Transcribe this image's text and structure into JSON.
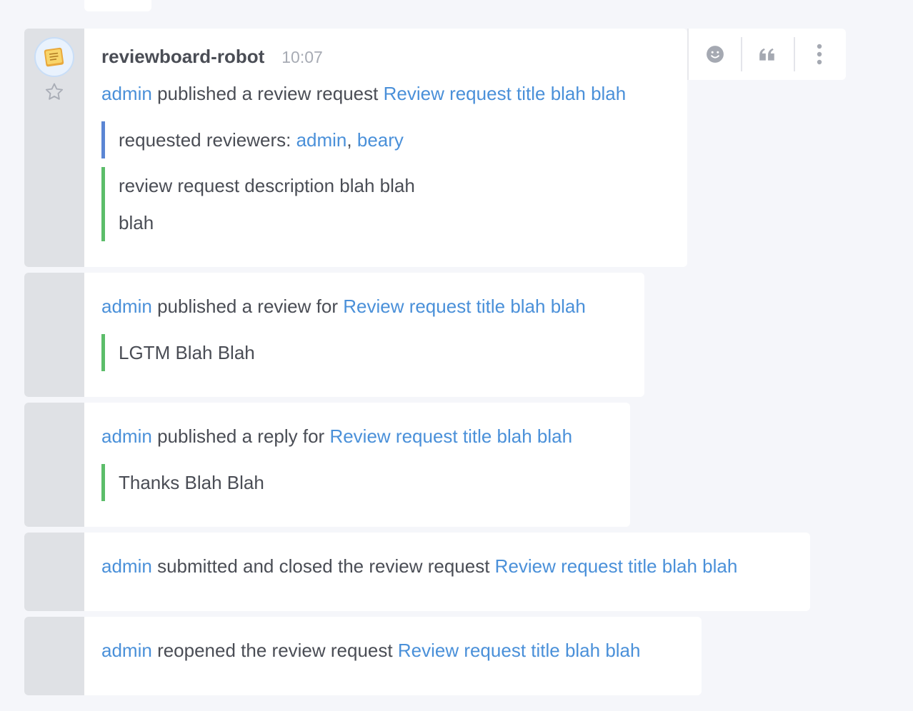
{
  "messages": {
    "m1": {
      "sender": "reviewboard-robot",
      "time": "10:07",
      "actor": "admin",
      "action": "published a review request",
      "link": "Review request title blah blah",
      "reviewers_prefix": "requested reviewers:",
      "reviewer_1": "admin",
      "reviewer_sep": ",",
      "reviewer_2": "beary",
      "description_line_1": "review request description blah blah",
      "description_line_2": "blah"
    },
    "m2": {
      "actor": "admin",
      "action": "published a review for",
      "link": "Review request title blah blah",
      "quote": "LGTM Blah Blah"
    },
    "m3": {
      "actor": "admin",
      "action": "published a reply for",
      "link": "Review request title blah blah",
      "quote": "Thanks Blah Blah"
    },
    "m4": {
      "actor": "admin",
      "action": "submitted and closed the review request",
      "link": "Review request title blah blah"
    },
    "m5": {
      "actor": "admin",
      "action": "reopened the review request",
      "link": "Review request title blah blah"
    }
  },
  "icons": {
    "avatar": "note-icon",
    "star": "star-icon",
    "toolbar": [
      "emoji-icon",
      "quote-icon",
      "more-vertical-icon"
    ]
  },
  "colors": {
    "link": "#4a90d9",
    "text": "#4a4d55",
    "time": "#a7abb4",
    "quote_bar_blue": "#5b86d4",
    "quote_bar_green": "#5cbd6a",
    "gutter": "#dfe1e5",
    "background": "#f5f6fa"
  }
}
